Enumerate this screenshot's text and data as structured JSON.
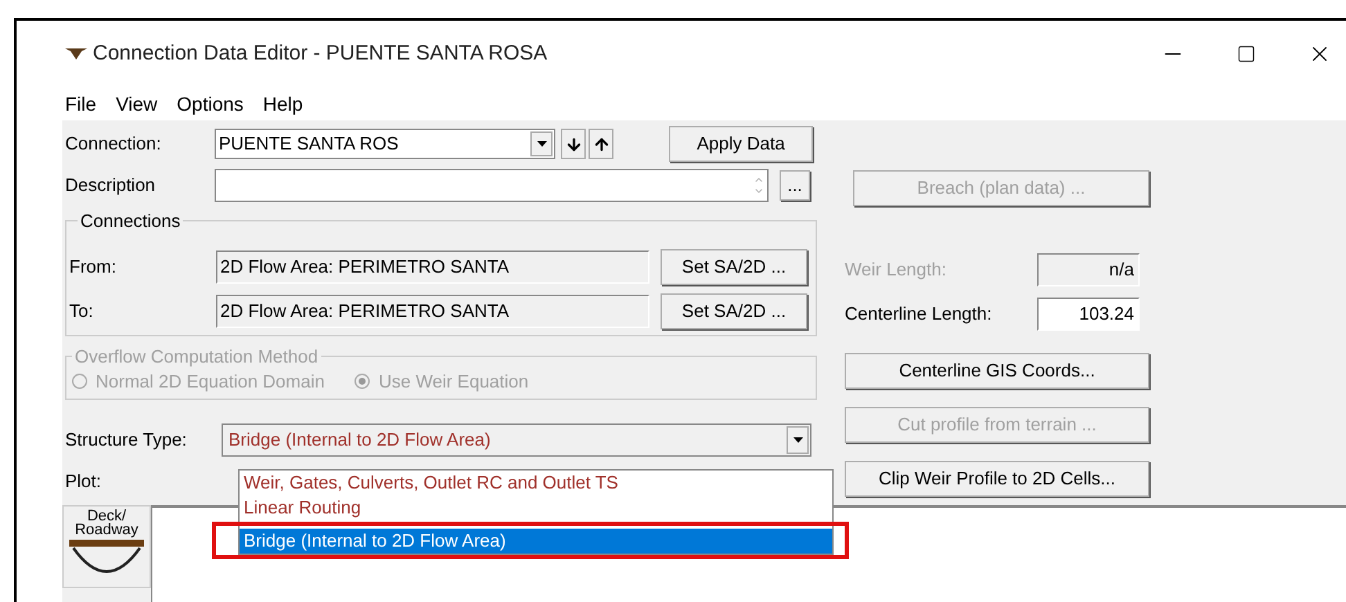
{
  "window": {
    "title": "Connection Data Editor - PUENTE SANTA ROSA"
  },
  "menu": [
    "File",
    "View",
    "Options",
    "Help"
  ],
  "connection": {
    "label": "Connection:",
    "value": "PUENTE SANTA ROS"
  },
  "apply_button": "Apply Data",
  "description": {
    "label": "Description",
    "more_button": "..."
  },
  "breach_button": {
    "label": "Breach (plan data) ...",
    "disabled": true
  },
  "connections": {
    "title": "Connections",
    "rows": [
      {
        "label": "From:",
        "value": "2D Flow Area: PERIMETRO SANTA",
        "button": "Set SA/2D ..."
      },
      {
        "label": "To:",
        "value": "2D Flow Area: PERIMETRO SANTA",
        "button": "Set SA/2D ..."
      }
    ]
  },
  "lengths": [
    {
      "label": "Weir Length:",
      "value": "n/a",
      "disabled": true
    },
    {
      "label": "Centerline Length:",
      "value": "103.24",
      "disabled": false
    }
  ],
  "overflow": {
    "title": "Overflow Computation Method",
    "disabled": true,
    "options": [
      {
        "label": "Normal 2D Equation Domain",
        "selected": false
      },
      {
        "label": "Use Weir Equation",
        "selected": true
      }
    ]
  },
  "side_buttons": [
    {
      "label": "Centerline GIS Coords...",
      "disabled": false
    },
    {
      "label": "Cut profile from terrain ...",
      "disabled": true
    },
    {
      "label": "Clip Weir Profile to 2D Cells...",
      "disabled": false
    }
  ],
  "structure_type": {
    "label": "Structure Type:",
    "value": "Bridge (Internal to 2D Flow Area)",
    "expanded": true,
    "options": [
      {
        "label": "Weir, Gates, Culverts, Outlet RC and Outlet TS",
        "selected": false
      },
      {
        "label": "Linear Routing",
        "selected": false
      },
      {
        "label": "Bridge (Internal to 2D Flow Area)",
        "selected": true
      }
    ]
  },
  "plot": {
    "label": "Plot:"
  },
  "deck_button": {
    "lines": [
      "Deck/",
      "Roadway"
    ]
  }
}
